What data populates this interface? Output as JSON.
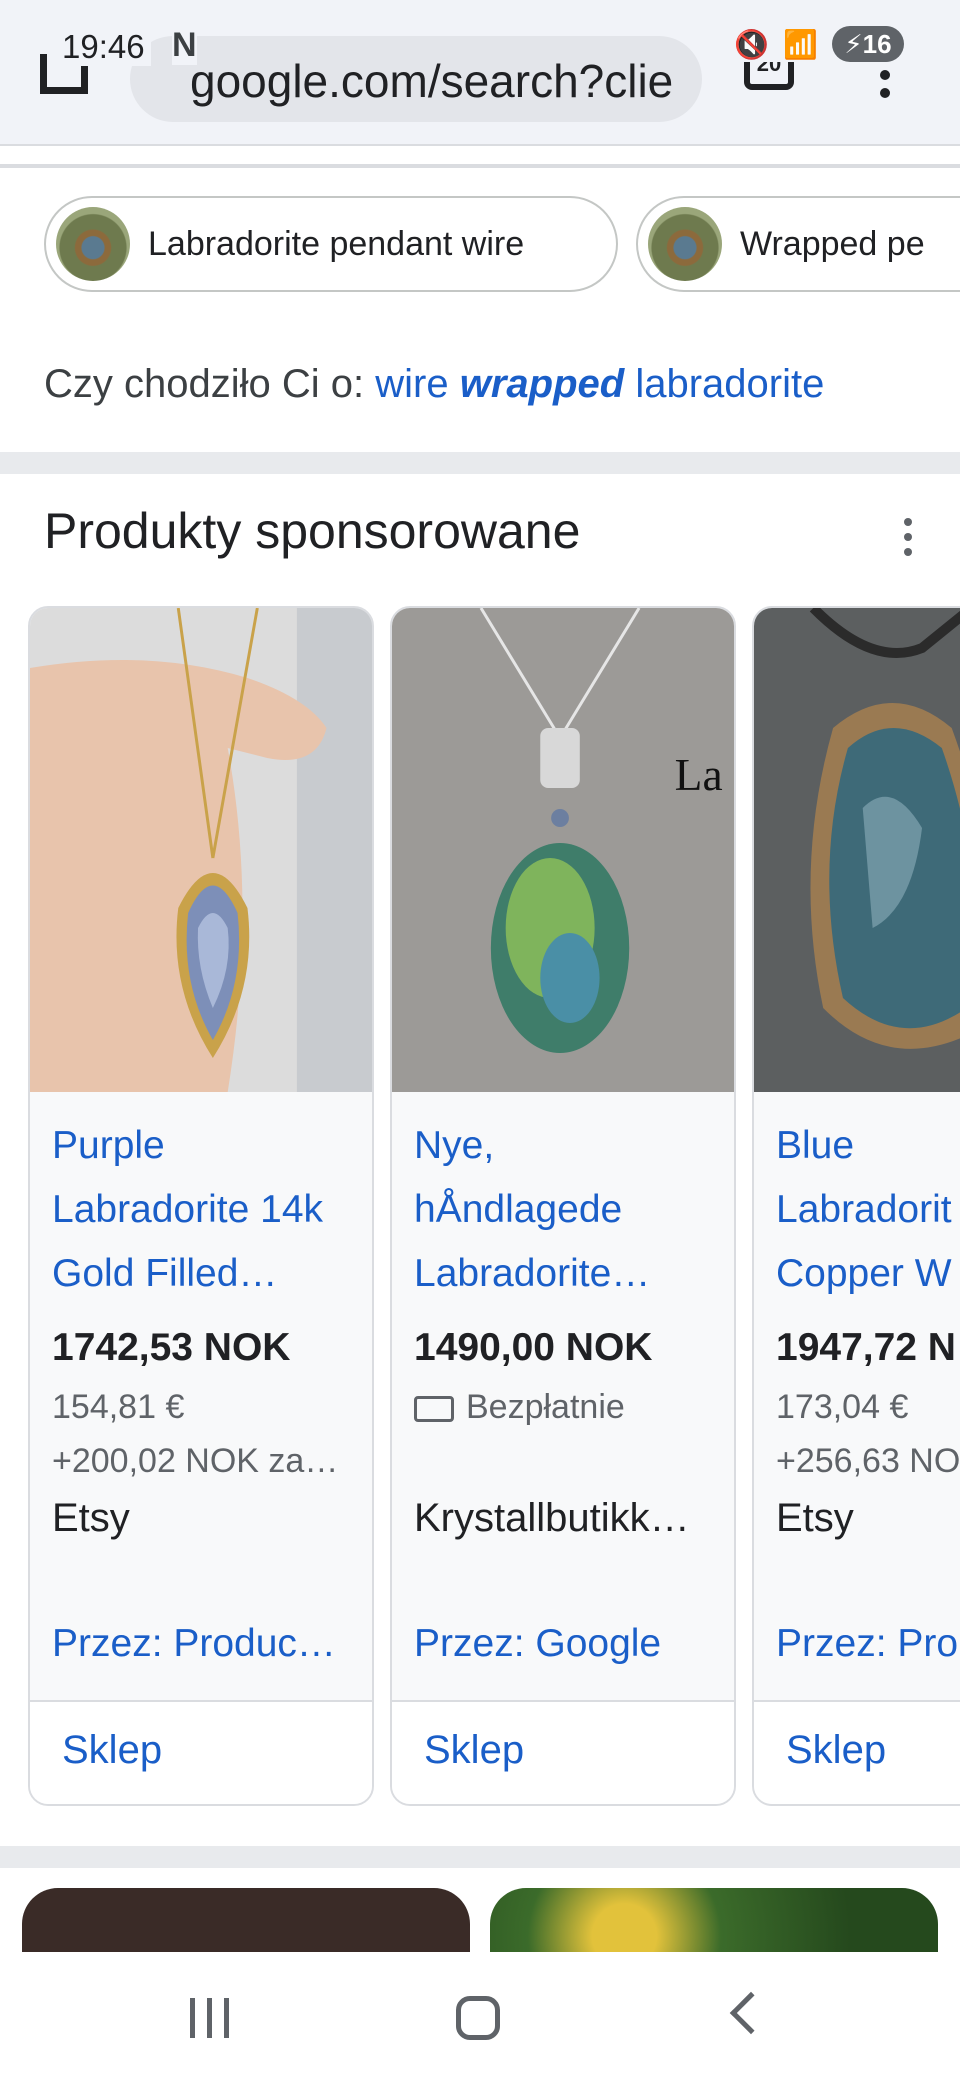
{
  "status_bar": {
    "time": "19:46",
    "notification": "N",
    "battery": "16"
  },
  "browser": {
    "url": "google.com/search?clie",
    "tab_count": "20"
  },
  "chips": [
    {
      "label": "Labradorite pendant wire"
    },
    {
      "label": "Wrapped pe"
    }
  ],
  "suggestion": {
    "prefix": "Czy chodziło Ci o:",
    "word1": "wire",
    "word2": "wrapped",
    "word3": "labradorite"
  },
  "sponsored": {
    "title": "Produkty sponsorowane",
    "products": [
      {
        "title": "Purple\nLabradorite 14k\nGold Filled…",
        "price": "1742,53 NOK",
        "line1": "154,81 €",
        "line2": "+200,02 NOK za…",
        "seller": "Etsy",
        "via": "Przez: Produc…",
        "action": "Sklep"
      },
      {
        "title": "Nye,\nhÅndlagede\nLabradorite…",
        "price": "1490,00 NOK",
        "line1": "Bezpłatnie",
        "line2": "",
        "seller": "Krystallbutikk…",
        "via": "Przez: Google",
        "action": "Sklep"
      },
      {
        "title": "Blue\nLabradorit\nCopper W",
        "price": "1947,72 N",
        "line1": "173,04 €",
        "line2": "+256,63 NO",
        "seller": "Etsy",
        "via": "Przez: Pro",
        "action": "Sklep"
      }
    ]
  },
  "colors": {
    "link": "#1a5ec8",
    "text": "#202124",
    "secondary": "#5f6368",
    "card_bg": "#f8f9fa"
  }
}
